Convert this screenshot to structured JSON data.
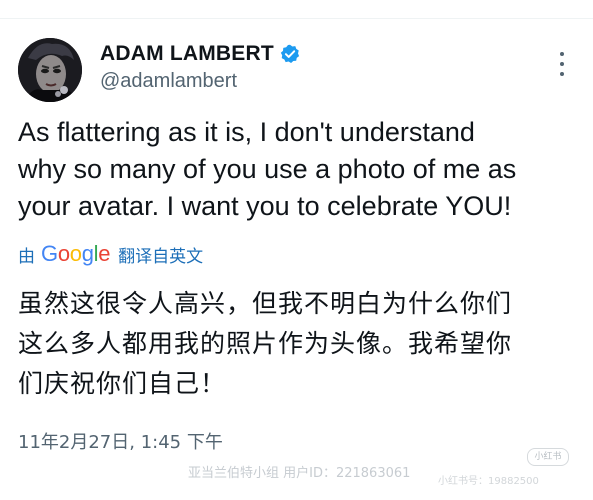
{
  "tweet": {
    "author": {
      "display_name": "ADAM LAMBERT",
      "handle": "@adamlambert",
      "verified": true,
      "verified_color": "#1d9bf0"
    },
    "more_icon": "more-vertical-icon",
    "text": "As flattering as it is, I don't understand\nwhy so many of you use a photo of me as\nyour avatar. I want you to celebrate YOU!",
    "translation": {
      "by_label": "由",
      "provider_letters": [
        "G",
        "o",
        "o",
        "g",
        "l",
        "e"
      ],
      "suffix_label": "翻译自英文",
      "link_color": "#1d6fb8",
      "text": "虽然这很令人高兴，但我不明白为什么你们\n这么多人都用我的照片作为头像。我希望你\n们庆祝你们自己！"
    },
    "timestamp": "11年2月27日, 1:45 下午"
  },
  "watermark": {
    "text": "亚当兰伯特小组  用户ID：221863061",
    "corner_stamp": "小红书",
    "faint_text": "小红书号：19882500"
  }
}
